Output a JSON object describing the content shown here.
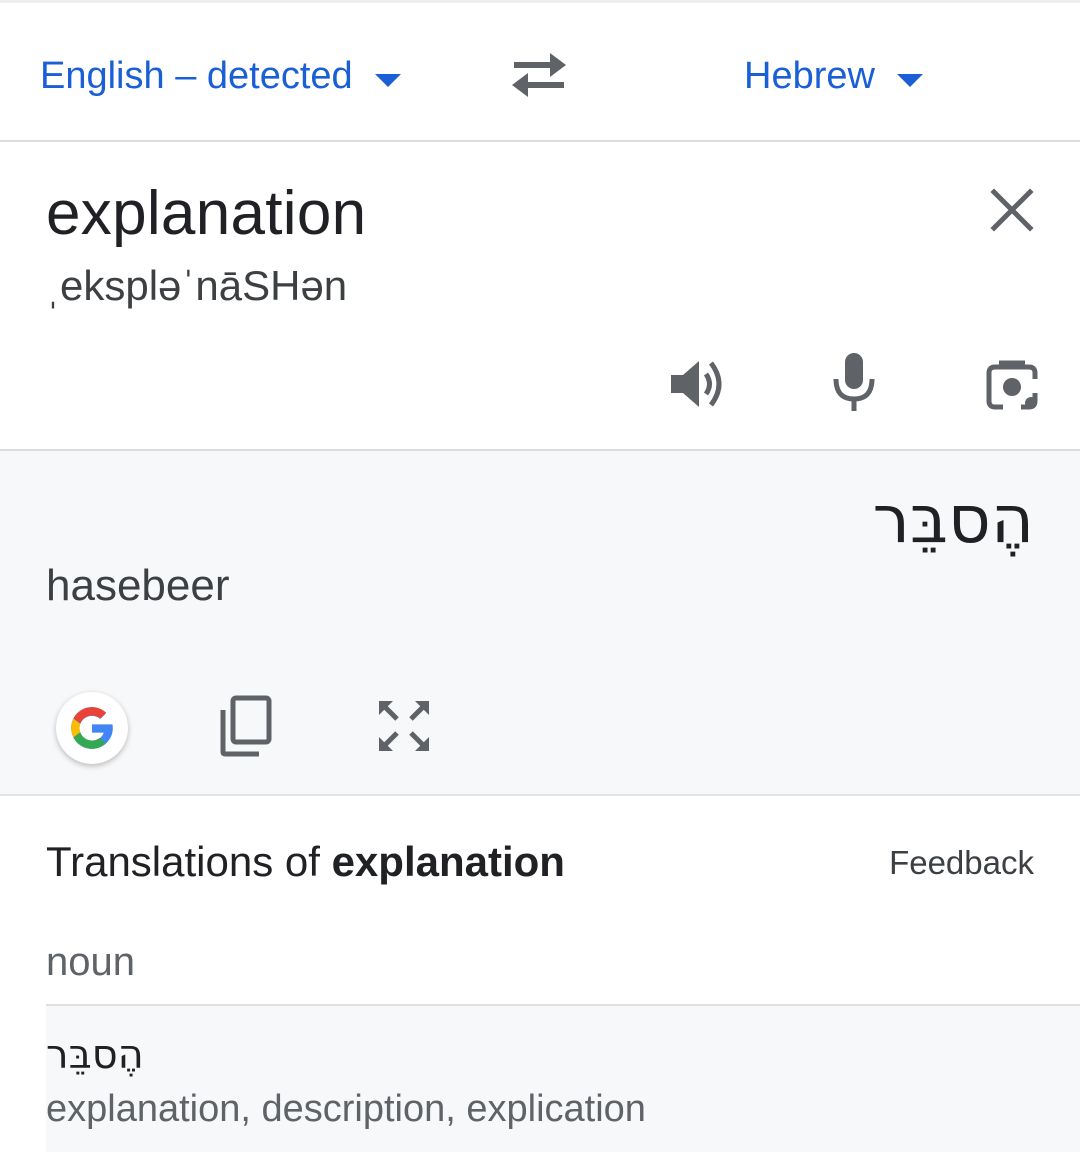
{
  "language_bar": {
    "source_language": "English – detected",
    "target_language": "Hebrew",
    "swap_icon": "swap-arrows-icon"
  },
  "source": {
    "text": "explanation",
    "phonetic": "ˌekspləˈnāSHən",
    "icons": [
      "close-icon",
      "speaker-icon",
      "microphone-icon",
      "camera-icon"
    ]
  },
  "result": {
    "text": "הֶסבֵּר",
    "transliteration": "hasebeer",
    "icons": [
      "google-icon",
      "copy-icon",
      "fullscreen-icon"
    ]
  },
  "translations": {
    "title_prefix": "Translations of",
    "title_word": "explanation",
    "feedback": "Feedback",
    "part_of_speech": "noun",
    "entries": [
      {
        "word": "הֶסבֵּר",
        "meanings": "explanation, description, explication"
      }
    ]
  },
  "colors": {
    "accent": "#1a5fd6",
    "result_background": "#f7f8fa",
    "icon_gray": "#5f6368"
  }
}
